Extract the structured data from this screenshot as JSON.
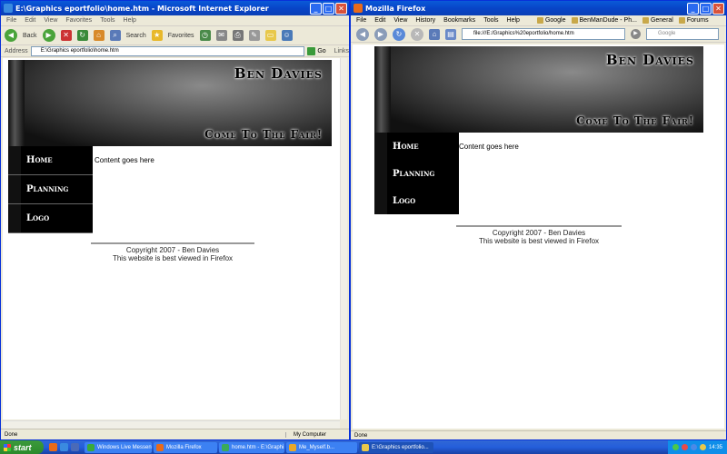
{
  "ie": {
    "title": "E:\\Graphics eportfolio\\home.htm - Microsoft Internet Explorer",
    "menu": [
      "File",
      "Edit",
      "View",
      "Favorites",
      "Tools",
      "Help"
    ],
    "toolbar": {
      "back": "Back",
      "search": "Search",
      "favorites": "Favorites"
    },
    "address_label": "Address",
    "address_value": "E:\\Graphics eportfolio\\home.htm",
    "go": "Go",
    "links": "Links",
    "status": "Done",
    "zone": "My Computer"
  },
  "firefox": {
    "title": "Mozilla Firefox",
    "menu": [
      "File",
      "Edit",
      "View",
      "History",
      "Bookmarks",
      "Tools",
      "Help"
    ],
    "bookmarks": [
      "Google",
      "BenManDude - Ph...",
      "General",
      "Forums"
    ],
    "url": "file:///E:/Graphics%20eportfolio/home.htm",
    "search_placeholder": "Google",
    "status": "Done"
  },
  "site": {
    "title": "Ben Davies",
    "tagline": "Come To The Fair!",
    "nav": [
      "Home",
      "Planning",
      "Logo"
    ],
    "content": "Content goes here",
    "footer_line1": "Copyright 2007 - Ben Davies",
    "footer_line2": "This website is best viewed in Firefox"
  },
  "taskbar": {
    "start": "start",
    "tasks": [
      "Windows Live Messen...",
      "Mozilla Firefox",
      "home.htm - E:\\Graphi...",
      "Me_Myself.b...",
      "E:\\Graphics eportfolio..."
    ],
    "clock": "14:35"
  },
  "colors": {
    "title_blue": "#0845c8",
    "taskbar_blue": "#245edb",
    "start_green": "#2b8a2b",
    "nav_bg": "#000000"
  }
}
